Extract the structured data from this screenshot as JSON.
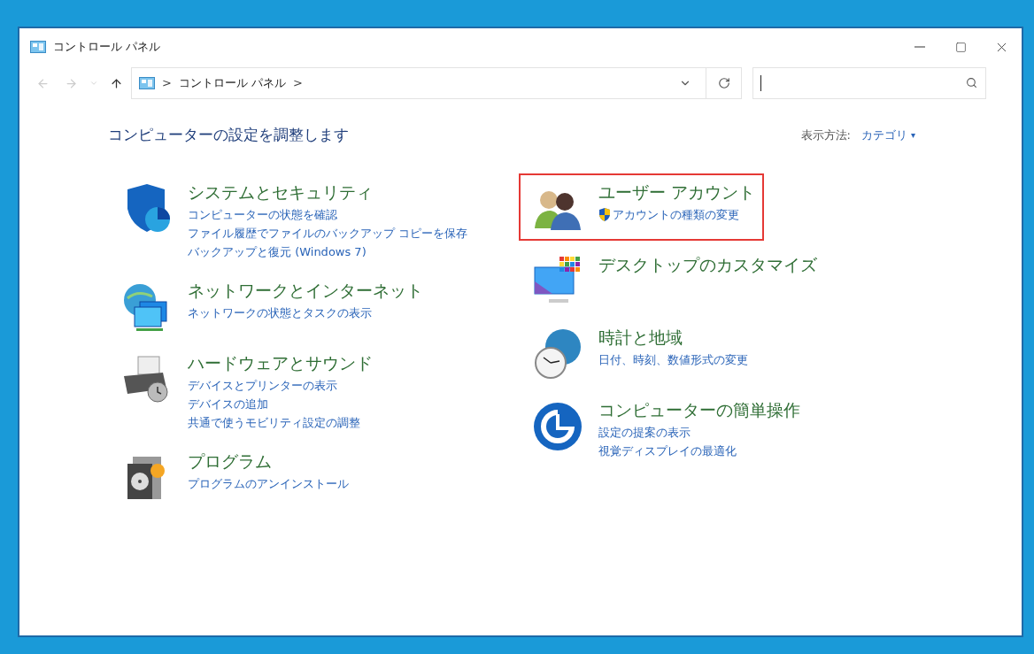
{
  "window": {
    "title": "コントロール パネル"
  },
  "address_bar": {
    "path": [
      ">",
      "コントロール パネル",
      ">"
    ]
  },
  "heading": "コンピューターの設定を調整します",
  "view_by": {
    "label": "表示方法:",
    "value": "カテゴリ",
    "caret": "▾"
  },
  "columns": [
    [
      {
        "kind": "system",
        "title": "システムとセキュリティ",
        "highlighted": false,
        "links": [
          {
            "text": "コンピューターの状態を確認",
            "shield": false
          },
          {
            "text": "ファイル履歴でファイルのバックアップ コピーを保存",
            "shield": false
          },
          {
            "text": "バックアップと復元 (Windows 7)",
            "shield": false
          }
        ]
      },
      {
        "kind": "network",
        "title": "ネットワークとインターネット",
        "highlighted": false,
        "links": [
          {
            "text": "ネットワークの状態とタスクの表示",
            "shield": false
          }
        ]
      },
      {
        "kind": "hardware",
        "title": "ハードウェアとサウンド",
        "highlighted": false,
        "links": [
          {
            "text": "デバイスとプリンターの表示",
            "shield": false
          },
          {
            "text": "デバイスの追加",
            "shield": false
          },
          {
            "text": "共通で使うモビリティ設定の調整",
            "shield": false
          }
        ]
      },
      {
        "kind": "programs",
        "title": "プログラム",
        "highlighted": false,
        "links": [
          {
            "text": "プログラムのアンインストール",
            "shield": false
          }
        ]
      }
    ],
    [
      {
        "kind": "users",
        "title": "ユーザー アカウント",
        "highlighted": true,
        "links": [
          {
            "text": "アカウントの種類の変更",
            "shield": true
          }
        ]
      },
      {
        "kind": "appearance",
        "title": "デスクトップのカスタマイズ",
        "highlighted": false
      },
      {
        "kind": "clock",
        "title": "時計と地域",
        "highlighted": false,
        "links": [
          {
            "text": "日付、時刻、数値形式の変更",
            "shield": false
          }
        ]
      },
      {
        "kind": "ease",
        "title": "コンピューターの簡単操作",
        "highlighted": false,
        "links": [
          {
            "text": "設定の提案の表示",
            "shield": false
          },
          {
            "text": "視覚ディスプレイの最適化",
            "shield": false
          }
        ]
      }
    ]
  ]
}
